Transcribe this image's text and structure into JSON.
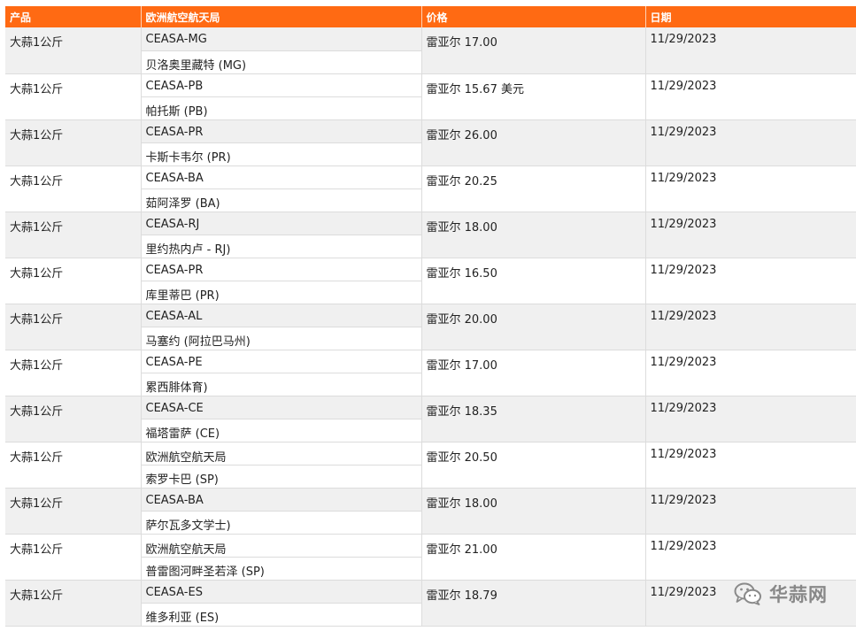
{
  "table": {
    "headers": {
      "product": "产品",
      "site": "欧洲航空航天局",
      "price": "价格",
      "date": "日期"
    },
    "rows": [
      {
        "product": "大蒜1公斤",
        "code": "CEASA-MG",
        "city": "贝洛奥里藏特 (MG)",
        "price": "雷亚尔 17.00",
        "date": "11/29/2023"
      },
      {
        "product": "大蒜1公斤",
        "code": "CEASA-PB",
        "city": "帕托斯 (PB)",
        "price": "雷亚尔 15.67 美元",
        "date": "11/29/2023"
      },
      {
        "product": "大蒜1公斤",
        "code": "CEASA-PR",
        "city": "卡斯卡韦尔 (PR)",
        "price": "雷亚尔 26.00",
        "date": "11/29/2023"
      },
      {
        "product": "大蒜1公斤",
        "code": "CEASA-BA",
        "city": "茹阿泽罗 (BA)",
        "price": "雷亚尔 20.25",
        "date": "11/29/2023"
      },
      {
        "product": "大蒜1公斤",
        "code": "CEASA-RJ",
        "city": "里约热内卢 - RJ)",
        "price": "雷亚尔 18.00",
        "date": "11/29/2023"
      },
      {
        "product": "大蒜1公斤",
        "code": "CEASA-PR",
        "city": "库里蒂巴 (PR)",
        "price": "雷亚尔 16.50",
        "date": "11/29/2023"
      },
      {
        "product": "大蒜1公斤",
        "code": "CEASA-AL",
        "city": "马塞约 (阿拉巴马州)",
        "price": "雷亚尔 20.00",
        "date": "11/29/2023"
      },
      {
        "product": "大蒜1公斤",
        "code": "CEASA-PE",
        "city": "累西腓体育)",
        "price": "雷亚尔 17.00",
        "date": "11/29/2023"
      },
      {
        "product": "大蒜1公斤",
        "code": "CEASA-CE",
        "city": "福塔雷萨 (CE)",
        "price": "雷亚尔 18.35",
        "date": "11/29/2023"
      },
      {
        "product": "大蒜1公斤",
        "code": "欧洲航空航天局",
        "city": "索罗卡巴 (SP)",
        "price": "雷亚尔 20.50",
        "date": "11/29/2023"
      },
      {
        "product": "大蒜1公斤",
        "code": "CEASA-BA",
        "city": "萨尔瓦多文学士)",
        "price": "雷亚尔 18.00",
        "date": "11/29/2023"
      },
      {
        "product": "大蒜1公斤",
        "code": "欧洲航空航天局",
        "city": "普雷图河畔圣若泽 (SP)",
        "price": "雷亚尔 21.00",
        "date": "11/29/2023"
      },
      {
        "product": "大蒜1公斤",
        "code": "CEASA-ES",
        "city": "维多利亚 (ES)",
        "price": "雷亚尔 18.79",
        "date": "11/29/2023"
      }
    ]
  },
  "watermark": {
    "text": "华蒜网",
    "icon": "wechat-icon"
  },
  "colors": {
    "header_bg": "#ff6a13",
    "header_text": "#ffffff",
    "stripe": "#f0f0f0",
    "border": "#dcdcdc"
  }
}
